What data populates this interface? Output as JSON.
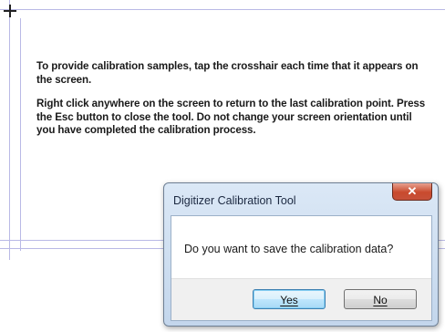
{
  "instructions": {
    "paragraph_1": "To provide calibration samples, tap the crosshair each time that it appears on the screen.",
    "paragraph_2": "Right click anywhere on the screen to return to the last calibration point. Press the Esc button to close the tool. Do not change your screen orientation until you have completed the calibration process."
  },
  "dialog": {
    "title": "Digitizer Calibration Tool",
    "close_label": "✕",
    "message": "Do you want to save the calibration data?",
    "yes_label": "Yes",
    "no_label": "No"
  },
  "colors": {
    "guide_lines": "#b9b9e6",
    "dialog_frame": "#c3d6ec",
    "close_button": "#c94a2d"
  }
}
